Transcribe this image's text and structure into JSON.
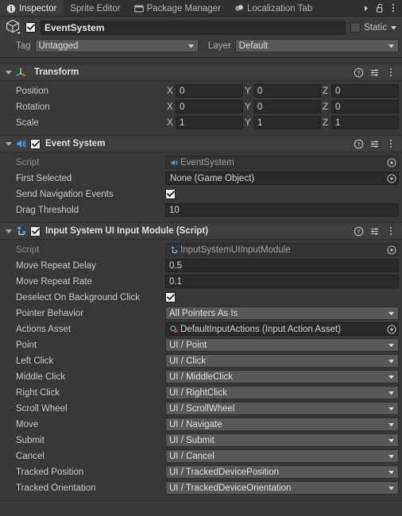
{
  "tabs": [
    {
      "label": "Inspector",
      "icon": "info-icon",
      "active": true
    },
    {
      "label": "Sprite Editor",
      "icon": "none",
      "active": false
    },
    {
      "label": "Package Manager",
      "icon": "package-icon",
      "active": false
    },
    {
      "label": "Localization Tab",
      "icon": "localization-icon",
      "active": false
    }
  ],
  "tabbar_buttons": {
    "overflow_label": "▶",
    "lock_name": "lock-icon",
    "menu_name": "kebab-menu-icon"
  },
  "gameobject": {
    "enabled": true,
    "name": "EventSystem",
    "name_placeholder": "Name",
    "static_label": "Static",
    "static_checked": false,
    "tag_label": "Tag",
    "tag_value": "Untagged",
    "layer_label": "Layer",
    "layer_value": "Default"
  },
  "components": [
    {
      "id": "transform",
      "title": "Transform",
      "icon": "transform-axis-icon",
      "expanded": true,
      "has_enable_toggle": false,
      "rows": [
        {
          "kind": "vector3",
          "label": "Position",
          "axes": [
            "X",
            "Y",
            "Z"
          ],
          "values": [
            "0",
            "0",
            "0"
          ]
        },
        {
          "kind": "vector3",
          "label": "Rotation",
          "axes": [
            "X",
            "Y",
            "Z"
          ],
          "values": [
            "0",
            "0",
            "0"
          ]
        },
        {
          "kind": "vector3",
          "label": "Scale",
          "axes": [
            "X",
            "Y",
            "Z"
          ],
          "values": [
            "1",
            "1",
            "1"
          ]
        }
      ]
    },
    {
      "id": "event-system",
      "title": "Event System",
      "icon": "event-system-icon",
      "expanded": true,
      "has_enable_toggle": true,
      "enabled": true,
      "rows": [
        {
          "kind": "object",
          "label": "Script",
          "value": "EventSystem",
          "icon": "event-system-icon",
          "disabled": true,
          "picker": true
        },
        {
          "kind": "object",
          "label": "First Selected",
          "value": "None (Game Object)",
          "icon": "none",
          "disabled": false,
          "picker": true
        },
        {
          "kind": "checkbox",
          "label": "Send Navigation Events",
          "checked": true
        },
        {
          "kind": "text",
          "label": "Drag Threshold",
          "value": "10"
        }
      ]
    },
    {
      "id": "input-system-ui-input-module",
      "title": "Input System UI Input Module (Script)",
      "icon": "script-icon",
      "expanded": true,
      "has_enable_toggle": true,
      "enabled": true,
      "rows": [
        {
          "kind": "object",
          "label": "Script",
          "value": "InputSystemUIInputModule",
          "icon": "script-icon",
          "disabled": true,
          "picker": true
        },
        {
          "kind": "text",
          "label": "Move Repeat Delay",
          "value": "0.5"
        },
        {
          "kind": "text",
          "label": "Move Repeat Rate",
          "value": "0.1"
        },
        {
          "kind": "checkbox",
          "label": "Deselect On Background Click",
          "checked": true
        },
        {
          "kind": "popup",
          "label": "Pointer Behavior",
          "value": "All Pointers As Is"
        },
        {
          "kind": "object",
          "label": "Actions Asset",
          "value": "DefaultInputActions (Input Action Asset)",
          "icon": "input-actions-icon",
          "disabled": false,
          "picker": true
        },
        {
          "kind": "popup",
          "label": "Point",
          "value": "UI / Point"
        },
        {
          "kind": "popup",
          "label": "Left Click",
          "value": "UI / Click"
        },
        {
          "kind": "popup",
          "label": "Middle Click",
          "value": "UI / MiddleClick"
        },
        {
          "kind": "popup",
          "label": "Right Click",
          "value": "UI / RightClick"
        },
        {
          "kind": "popup",
          "label": "Scroll Wheel",
          "value": "UI / ScrollWheel"
        },
        {
          "kind": "popup",
          "label": "Move",
          "value": "UI / Navigate"
        },
        {
          "kind": "popup",
          "label": "Submit",
          "value": "UI / Submit"
        },
        {
          "kind": "popup",
          "label": "Cancel",
          "value": "UI / Cancel"
        },
        {
          "kind": "popup",
          "label": "Tracked Position",
          "value": "UI / TrackedDevicePosition"
        },
        {
          "kind": "popup",
          "label": "Tracked Orientation",
          "value": "UI / TrackedDeviceOrientation"
        }
      ]
    }
  ],
  "component_header_buttons": {
    "help": "help-icon",
    "preset": "preset-icon",
    "menu": "kebab-menu-icon"
  },
  "colors": {
    "window_bg": "#383838",
    "tabbar_bg": "#303030",
    "active_tab_bg": "#3c3c3c",
    "component_header_bg": "#3e3e3e",
    "text_field_bg": "#2a2a2a",
    "popup_bg": "#585858",
    "accent_blue": "#4f9fe0",
    "text_primary": "#c8c8c8",
    "text_dim": "#8c8c8c"
  }
}
